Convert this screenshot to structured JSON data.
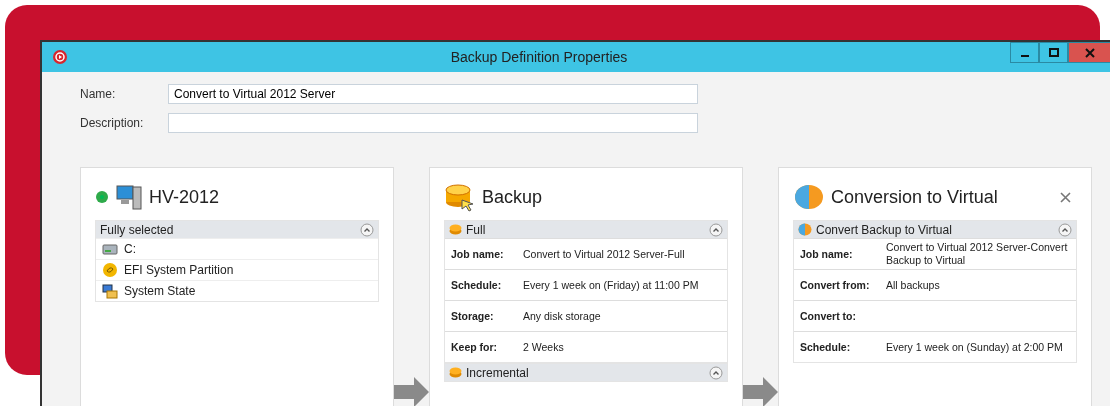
{
  "window": {
    "title": "Backup Definition Properties"
  },
  "fields": [
    {
      "label": "Name:",
      "value": "Convert to Virtual 2012 Server"
    },
    {
      "label": "Description:"
    }
  ],
  "panels": [
    {
      "kind": "source",
      "title": "HV-2012",
      "closable": false,
      "sections": [
        {
          "title": "Fully selected",
          "kind": "items",
          "expanded": true,
          "items": [
            {
              "kind": "drive",
              "label": "C:"
            },
            {
              "kind": "partition",
              "label": "EFI System Partition"
            },
            {
              "kind": "state",
              "label": "System State"
            }
          ]
        }
      ]
    },
    {
      "kind": "backup",
      "title": "Backup",
      "closable": false,
      "sections": [
        {
          "title": "Full",
          "kind": "properties",
          "expanded": true,
          "rows": [
            {
              "label": "Job name:",
              "value": "Convert to Virtual 2012 Server-Full"
            },
            {
              "label": "Schedule:",
              "value": "Every 1 week on (Friday) at 11:00 PM"
            },
            {
              "label": "Storage:",
              "value": "Any disk storage"
            },
            {
              "label": "Keep for:",
              "value": "2 Weeks"
            }
          ]
        },
        {
          "title": "Incremental",
          "kind": "properties",
          "expanded": true
        }
      ]
    },
    {
      "kind": "conversion",
      "title": "Conversion to Virtual",
      "closable": true,
      "sections": [
        {
          "title": "Convert Backup to Virtual",
          "kind": "properties",
          "expanded": true,
          "rows": [
            {
              "label": "Job name:",
              "value": "Convert to Virtual 2012 Server-Convert Backup to Virtual"
            },
            {
              "label": "Convert from:",
              "value": "All backups"
            },
            {
              "label": "Convert to:"
            },
            {
              "label": "Schedule:",
              "value": "Every 1 week on (Sunday) at 2:00 PM"
            }
          ]
        }
      ]
    }
  ]
}
